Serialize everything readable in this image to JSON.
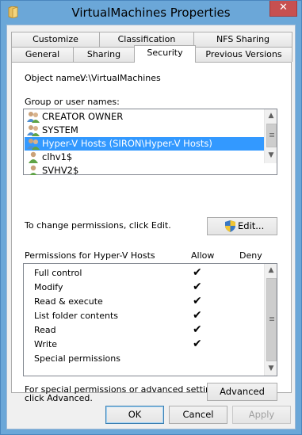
{
  "window": {
    "title": "VirtualMachines Properties",
    "close_glyph": "✕"
  },
  "tabs": {
    "row1": [
      "Customize",
      "Classification",
      "NFS Sharing"
    ],
    "row2": [
      "General",
      "Sharing",
      "Security",
      "Previous Versions"
    ],
    "active": "Security"
  },
  "security": {
    "object_label": "Object name:",
    "object_value": "V:\\VirtualMachines",
    "group_label": "Group or user names:",
    "users": [
      {
        "name": "CREATOR OWNER",
        "icon": "group-icon"
      },
      {
        "name": "SYSTEM",
        "icon": "group-icon"
      },
      {
        "name": "Hyper-V Hosts (SIRON\\Hyper-V Hosts)",
        "icon": "group-icon",
        "selected": true
      },
      {
        "name": "clhv1$",
        "icon": "user-icon"
      },
      {
        "name": "SVHV2$",
        "icon": "user-icon"
      }
    ],
    "change_text": "To change permissions, click Edit.",
    "edit_label": "Edit...",
    "perm_header": "Permissions for Hyper-V Hosts",
    "allow_header": "Allow",
    "deny_header": "Deny",
    "permissions": [
      {
        "name": "Full control",
        "allow": "✔",
        "deny": ""
      },
      {
        "name": "Modify",
        "allow": "✔",
        "deny": ""
      },
      {
        "name": "Read & execute",
        "allow": "✔",
        "deny": ""
      },
      {
        "name": "List folder contents",
        "allow": "✔",
        "deny": ""
      },
      {
        "name": "Read",
        "allow": "✔",
        "deny": ""
      },
      {
        "name": "Write",
        "allow": "✔",
        "deny": ""
      },
      {
        "name": "Special permissions",
        "allow": "",
        "deny": ""
      }
    ],
    "advanced_text_1": "For special permissions or advanced settings,",
    "advanced_text_2": "click Advanced.",
    "advanced_label": "Advanced"
  },
  "footer": {
    "ok_label": "OK",
    "cancel_label": "Cancel",
    "apply_label": "Apply"
  },
  "colors": {
    "title_bar": "#6ba7d8",
    "selection": "#3399ff",
    "close_button": "#c75050"
  }
}
